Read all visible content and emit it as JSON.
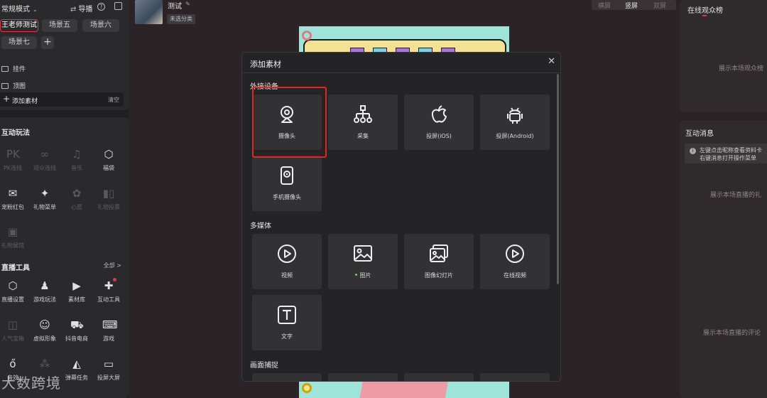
{
  "scene_panel": {
    "mode_label": "常规模式",
    "guide_label": "导播",
    "scene_tabs": [
      "王老师测试",
      "场景五",
      "场景六",
      "场景七"
    ],
    "sources": [
      "挂件",
      "顶图"
    ],
    "add_material_label": "添加素材",
    "clear_label": "清空"
  },
  "interact_panel": {
    "title": "互动玩法",
    "tools": [
      {
        "label": "PK连线",
        "icon": "pk-icon",
        "dim": true
      },
      {
        "label": "观众连线",
        "icon": "audience-link-icon",
        "dim": true
      },
      {
        "label": "音乐",
        "icon": "music-icon",
        "dim": true
      },
      {
        "label": "福袋",
        "icon": "lucky-bag-icon",
        "dim": false
      },
      {
        "label": "宠粉红包",
        "icon": "red-packet-icon",
        "dim": false
      },
      {
        "label": "礼物菜单",
        "icon": "gift-menu-icon",
        "dim": false
      },
      {
        "label": "心愿",
        "icon": "wish-icon",
        "dim": true
      },
      {
        "label": "礼物投票",
        "icon": "gift-vote-icon",
        "dim": true
      },
      {
        "label": "礼物展馆",
        "icon": "gift-gallery-icon",
        "dim": true
      }
    ]
  },
  "live_tools": {
    "title": "直播工具",
    "all_label": "全部 >",
    "tools": [
      {
        "label": "直播设置",
        "icon": "live-settings-icon",
        "dim": false
      },
      {
        "label": "游戏玩法",
        "icon": "game-play-icon",
        "dim": false
      },
      {
        "label": "素材库",
        "icon": "material-library-icon",
        "dim": false
      },
      {
        "label": "互动工具",
        "icon": "interactive-tools-icon",
        "dim": false
      },
      {
        "label": "人气宝箱",
        "icon": "popularity-box-icon",
        "dim": true
      },
      {
        "label": "虚拟形象",
        "icon": "avatar-figure-icon",
        "dim": false
      },
      {
        "label": "抖音电商",
        "icon": "ecommerce-icon",
        "dim": false
      },
      {
        "label": "游戏",
        "icon": "gamepad-icon",
        "dim": false
      },
      {
        "label": "音效",
        "icon": "sound-effect-icon",
        "dim": false
      },
      {
        "label": "",
        "icon": "partial-icon",
        "dim": true
      },
      {
        "label": "弹幕任务",
        "icon": "danmaku-task-icon",
        "dim": false
      },
      {
        "label": "投屏大屏",
        "icon": "cast-screen-icon",
        "dim": false
      }
    ]
  },
  "room": {
    "title": "测试",
    "category": "未选分类"
  },
  "layout_tabs": [
    "横屏",
    "竖屏",
    "双屏"
  ],
  "layout_active": "竖屏",
  "viewers_panel": {
    "title": "在线观众榜",
    "hint": "展示本场观众榜"
  },
  "messages_panel": {
    "title": "互动消息",
    "notice_line1": "左键点击昵称查看资料卡",
    "notice_line2": "右键消息打开操作菜单",
    "hint_gift": "展示本场直播的礼",
    "hint_comment": "展示本场直播的评论"
  },
  "modal": {
    "title": "添加素材",
    "sections": [
      {
        "title": "外接设备",
        "items": [
          {
            "label": "摄像头",
            "icon": "webcam-icon"
          },
          {
            "label": "采集",
            "icon": "capture-device-icon"
          },
          {
            "label": "投屏(iOS)",
            "icon": "apple-icon"
          },
          {
            "label": "投屏(Android)",
            "icon": "android-icon"
          },
          {
            "label": "手机摄像头",
            "icon": "phone-camera-icon"
          }
        ]
      },
      {
        "title": "多媒体",
        "items": [
          {
            "label": "视频",
            "icon": "video-play-icon"
          },
          {
            "label": "图片",
            "icon": "image-icon"
          },
          {
            "label": "图像幻灯片",
            "icon": "slideshow-icon"
          },
          {
            "label": "在线视频",
            "icon": "online-video-icon"
          },
          {
            "label": "文字",
            "icon": "text-icon"
          }
        ]
      },
      {
        "title": "画面捕捉",
        "items": []
      }
    ]
  },
  "watermark": "大数跨境",
  "colors": {
    "accent_red": "#e5334b",
    "highlight_red": "#e12424",
    "modal_bg": "#242426",
    "card_bg": "#323235"
  }
}
